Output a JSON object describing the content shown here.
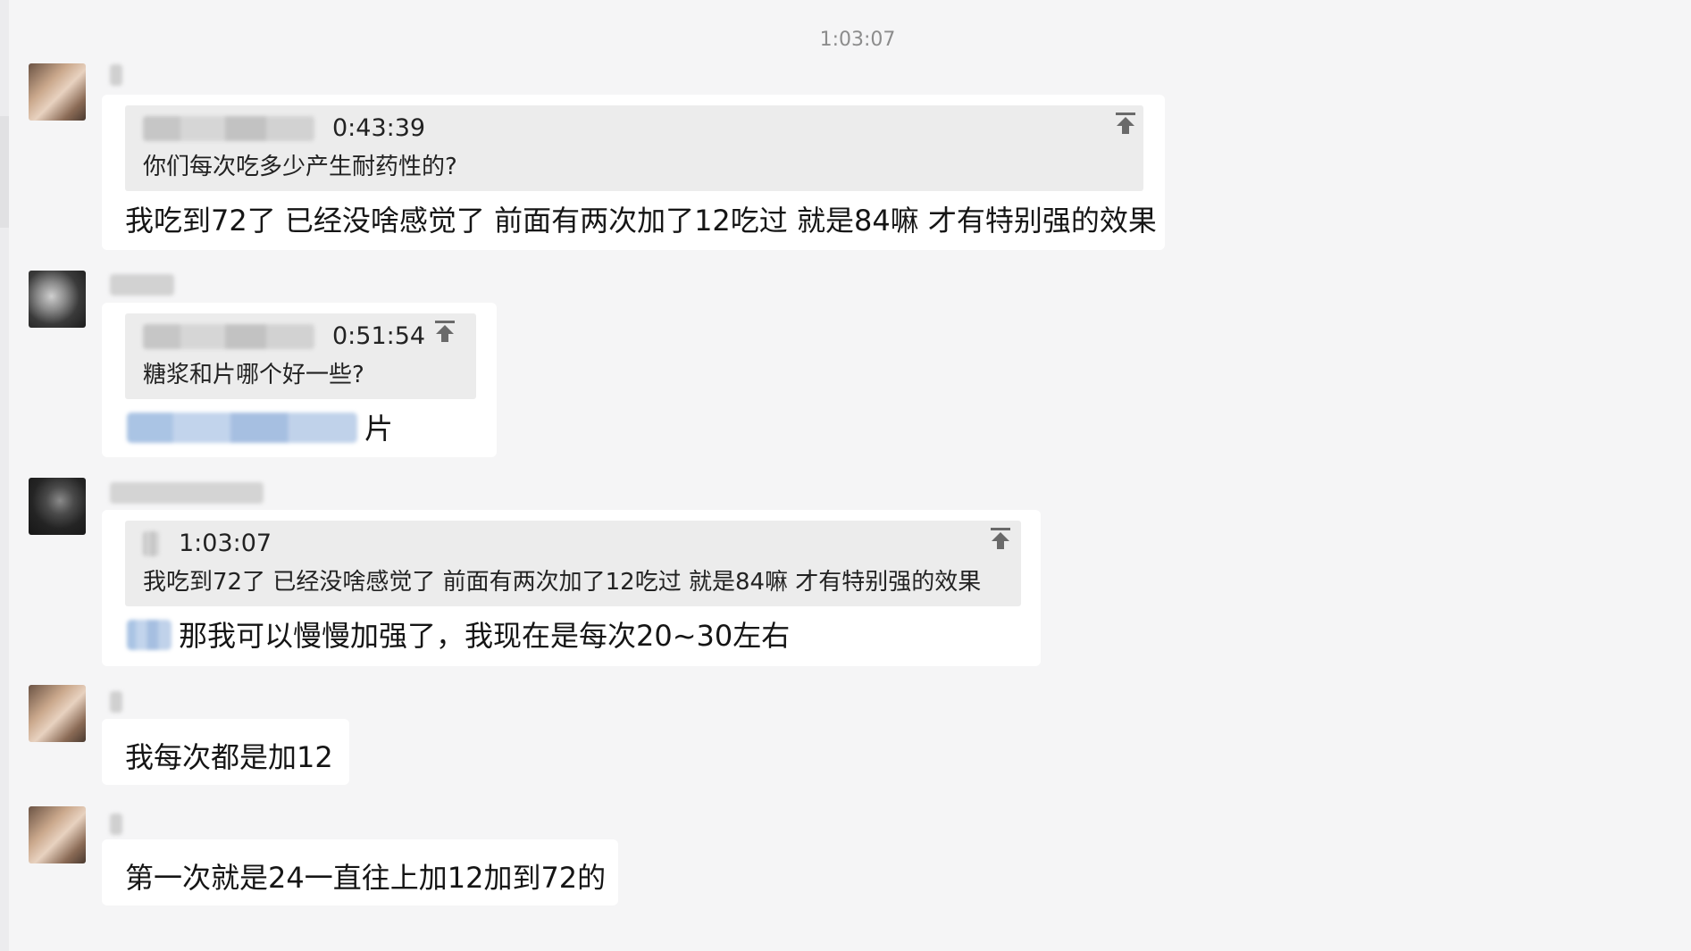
{
  "header": {
    "timestamp": "1:03:07"
  },
  "messages": [
    {
      "quote": {
        "time": "0:43:39",
        "text": "你们每次吃多少产生耐药性的?"
      },
      "text": "我吃到72了 已经没啥感觉了 前面有两次加了12吃过 就是84嘛 才有特别强的效果"
    },
    {
      "quote": {
        "time": "0:51:54",
        "text": "糖浆和片哪个好一些?"
      },
      "text": "片"
    },
    {
      "quote": {
        "time": "1:03:07",
        "text": "我吃到72了 已经没啥感觉了 前面有两次加了12吃过 就是84嘛 才有特别强的效果"
      },
      "text": "那我可以慢慢加强了，我现在是每次20~30左右"
    },
    {
      "text": "我每次都是加12"
    },
    {
      "text": "第一次就是24一直往上加12加到72的"
    }
  ],
  "icons": {
    "pin": "pin-to-top-icon",
    "avatar": "user-avatar"
  },
  "colors": {
    "background": "#f5f5f6",
    "bubble": "#ffffff",
    "quote": "#ececec",
    "timestamp": "#8c8c8c",
    "mention": "#aac4e4"
  }
}
